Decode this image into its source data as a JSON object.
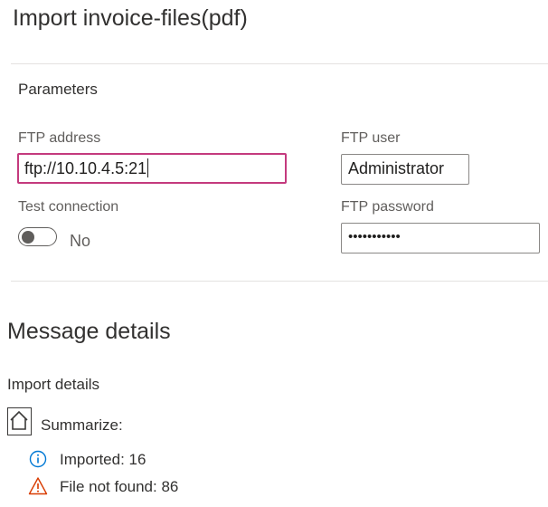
{
  "page": {
    "title": "Import invoice-files(pdf)"
  },
  "parameters": {
    "section_label": "Parameters",
    "ftp_address": {
      "label": "FTP address",
      "value": "ftp://10.10.4.5:21"
    },
    "ftp_user": {
      "label": "FTP user",
      "value": "Administrator"
    },
    "test_connection": {
      "label": "Test connection",
      "state_text": "No"
    },
    "ftp_password": {
      "label": "FTP password",
      "value": "•••••••••••"
    }
  },
  "messages": {
    "heading": "Message details",
    "import_details_label": "Import details",
    "summarize_label": "Summarize:",
    "items": [
      {
        "icon": "info-circle-icon",
        "text": "Imported: 16"
      },
      {
        "icon": "warning-triangle-icon",
        "text": "File not found: 86"
      }
    ]
  },
  "colors": {
    "focus_border": "#c43a7e",
    "info_icon": "#0078d4",
    "warning_icon": "#d83b01"
  }
}
